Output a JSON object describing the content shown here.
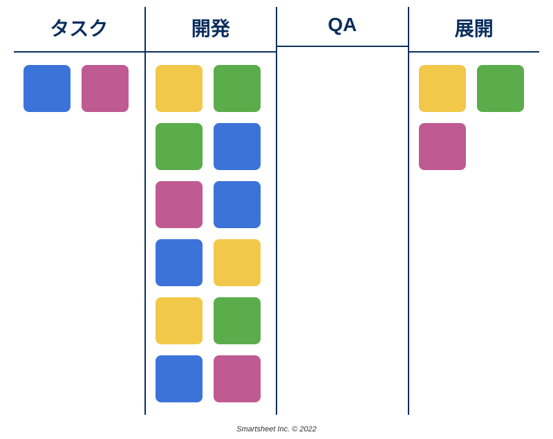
{
  "colors": {
    "blue": "#3b73d9",
    "pink": "#c05a92",
    "yellow": "#f2c84b",
    "green": "#5aad4a",
    "border": "#0a2e5c"
  },
  "columns": [
    {
      "id": "tasks",
      "label": "タスク",
      "cards": [
        "blue",
        "pink"
      ]
    },
    {
      "id": "dev",
      "label": "開発",
      "cards": [
        "yellow",
        "green",
        "green",
        "blue",
        "pink",
        "blue",
        "blue",
        "yellow",
        "yellow",
        "green",
        "blue",
        "pink"
      ]
    },
    {
      "id": "qa",
      "label": "QA",
      "cards": []
    },
    {
      "id": "deploy",
      "label": "展開",
      "cards": [
        "yellow",
        "green",
        "pink"
      ]
    }
  ],
  "footer": "Smartsheet Inc. © 2022"
}
